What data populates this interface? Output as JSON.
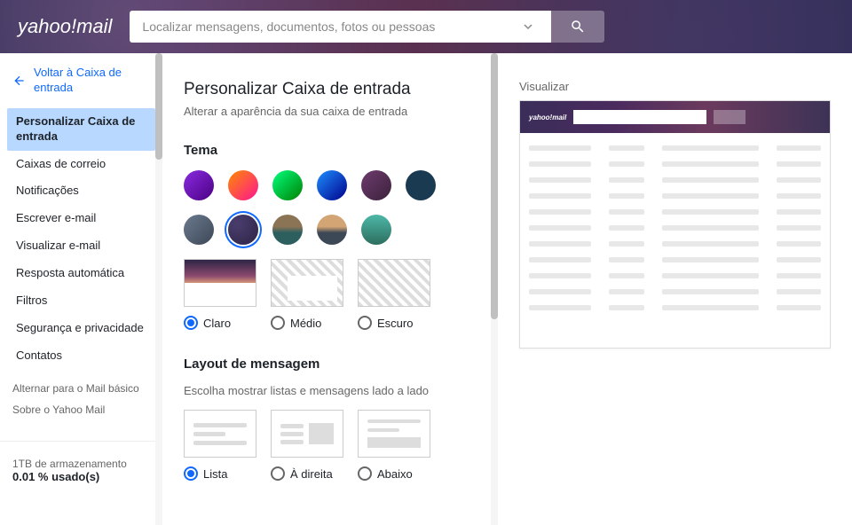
{
  "header": {
    "logo_prefix": "yahoo!",
    "logo_suffix": "mail",
    "search_placeholder": "Localizar mensagens, documentos, fotos ou pessoas"
  },
  "sidebar": {
    "back_label": "Voltar à Caixa de entrada",
    "items": [
      "Personalizar Caixa de entrada",
      "Caixas de correio",
      "Notificações",
      "Escrever e-mail",
      "Visualizar e-mail",
      "Resposta automática",
      "Filtros",
      "Segurança e privacidade",
      "Contatos"
    ],
    "switch_basic": "Alternar para o Mail básico",
    "about": "Sobre o Yahoo Mail",
    "storage_total": "1TB de armazenamento",
    "storage_used": "0.01 % usado(s)"
  },
  "settings": {
    "title": "Personalizar Caixa de entrada",
    "subtitle": "Alterar a aparência da sua caixa de entrada",
    "theme_heading": "Tema",
    "mode_light": "Claro",
    "mode_medium": "Médio",
    "mode_dark": "Escuro",
    "layout_heading": "Layout de mensagem",
    "layout_sub": "Escolha mostrar listas e mensagens lado a lado",
    "layout_list": "Lista",
    "layout_right": "À direita",
    "layout_below": "Abaixo"
  },
  "preview": {
    "label": "Visualizar",
    "mini_logo": "yahoo!mail"
  }
}
